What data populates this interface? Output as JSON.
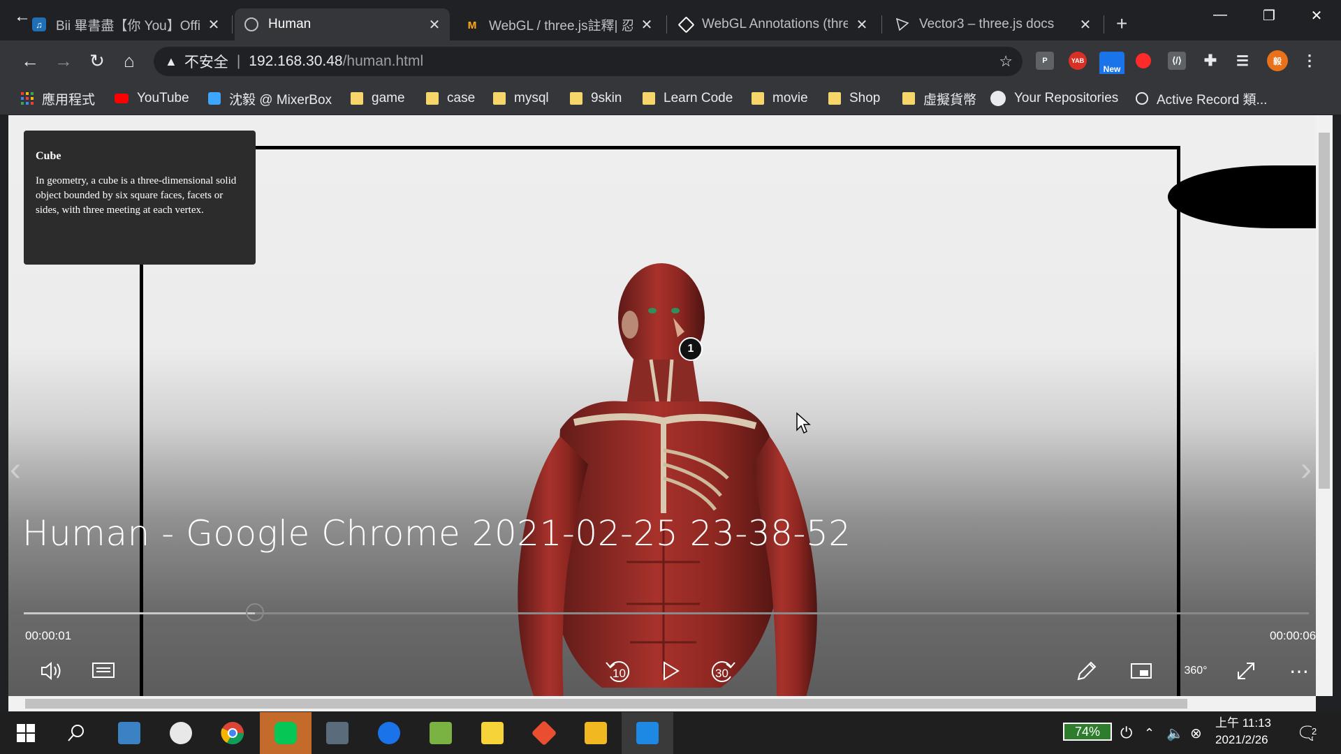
{
  "browser": {
    "tabs": [
      {
        "title": "Bii 畢書盡【你 You】Offici",
        "favicon": "music-note-icon"
      },
      {
        "title": "Human",
        "favicon": "globe-icon",
        "active": true
      },
      {
        "title": "WebGL / three.js註釋| 忍者",
        "favicon": "m-logo-icon"
      },
      {
        "title": "WebGL Annotations (thre",
        "favicon": "codepen-icon"
      },
      {
        "title": "Vector3 – three.js docs",
        "favicon": "threejs-icon"
      }
    ],
    "new_tab_label": "+",
    "omnibox": {
      "insecure_label": "不安全",
      "host": "192.168.30.48",
      "path": "/human.html"
    },
    "extension_new_badge": "New",
    "extension_yab_label": "YAB",
    "extension_p_label": "P",
    "profile_label": "毅",
    "bookmarks": [
      {
        "label": "應用程式",
        "icon": "apps-grid-icon"
      },
      {
        "label": "YouTube",
        "icon": "youtube-icon"
      },
      {
        "label": "沈毅 @ MixerBox",
        "icon": "mixerbox-icon"
      },
      {
        "label": "game",
        "icon": "folder-icon"
      },
      {
        "label": "case",
        "icon": "folder-icon"
      },
      {
        "label": "mysql",
        "icon": "folder-icon"
      },
      {
        "label": "9skin",
        "icon": "folder-icon"
      },
      {
        "label": "Learn Code",
        "icon": "folder-icon"
      },
      {
        "label": "movie",
        "icon": "folder-icon"
      },
      {
        "label": "Shop",
        "icon": "folder-icon"
      },
      {
        "label": "虛擬貨幣",
        "icon": "folder-icon"
      },
      {
        "label": "Your Repositories",
        "icon": "github-icon"
      },
      {
        "label": "Active Record 類...",
        "icon": "globe-icon"
      }
    ]
  },
  "annotation": {
    "title": "Cube",
    "body": "In geometry, a cube is a three-dimensional solid object bounded by six square faces, facets or sides, with three meeting at each vertex."
  },
  "marker_label": "1",
  "player": {
    "title": "Human - Google Chrome 2021-02-25 23-38-52",
    "current_time": "00:00:01",
    "total_time": "00:00:06",
    "progress_fraction": 0.18,
    "rewind_label": "10",
    "forward_label": "30",
    "vr_label": "360°"
  },
  "taskbar": {
    "battery": "74%",
    "clock_time": "上午 11:13",
    "clock_date": "2021/2/26",
    "notification_count": "2"
  },
  "colors": {
    "chrome_dark": "#202124",
    "chrome_toolbar": "#35363a",
    "line_green": "#06c755",
    "youtube_red": "#ff0000",
    "profile_orange": "#e8711a"
  }
}
